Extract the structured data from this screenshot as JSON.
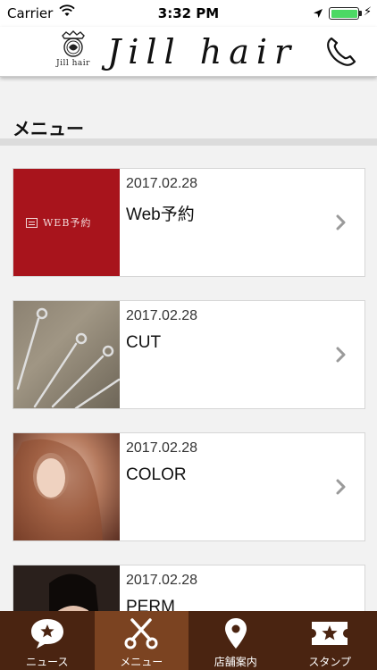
{
  "status_bar": {
    "carrier": "Carrier",
    "time": "3:32 PM"
  },
  "header": {
    "brand_wordmark": "Jill hair",
    "brand_small": "Jill hair"
  },
  "page": {
    "title": "メニュー"
  },
  "menu_items": [
    {
      "date": "2017.02.28",
      "name": "Web予約",
      "thumb_text": "WEB予約"
    },
    {
      "date": "2017.02.28",
      "name": "CUT"
    },
    {
      "date": "2017.02.28",
      "name": "COLOR"
    },
    {
      "date": "2017.02.28",
      "name": "PERM"
    }
  ],
  "tabs": [
    {
      "label": "ニュース",
      "icon": "news-bubble-icon"
    },
    {
      "label": "メニュー",
      "icon": "scissors-icon",
      "active": true
    },
    {
      "label": "店舗案内",
      "icon": "map-pin-icon"
    },
    {
      "label": "スタンプ",
      "icon": "stamp-ticket-icon"
    }
  ],
  "colors": {
    "brand_dark": "#4a2411",
    "brand_active": "#7b4321",
    "web_red": "#a8141c",
    "battery_green": "#4cd964"
  }
}
